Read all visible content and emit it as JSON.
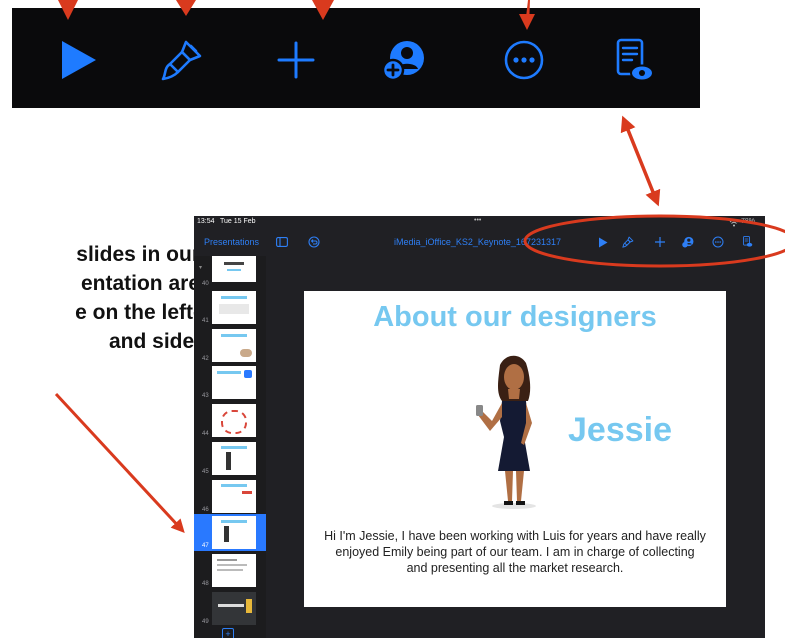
{
  "callout": {
    "lines": [
      "slides in our",
      "entation are",
      "e on the left-",
      "and side."
    ]
  },
  "toolbar_zoom": {
    "icons": [
      "play-icon",
      "format-brush-icon",
      "plus-icon",
      "collaborate-icon",
      "more-icon",
      "presenter-notes-icon"
    ],
    "accent": "#1e7bff"
  },
  "status_bar": {
    "time": "13:54",
    "date": "Tue 15 Feb",
    "dots": "•••",
    "battery": "78%"
  },
  "app_bar": {
    "back_label": "Presentations",
    "doc_title": "iMedia_iOffice_KS2_Keynote_16",
    "doc_title_suffix": "7231317"
  },
  "sidebar": {
    "slide_numbers": [
      "40",
      "41",
      "42",
      "43",
      "44",
      "45",
      "46",
      "47",
      "48",
      "49"
    ],
    "selected": "47",
    "add_label": "+"
  },
  "slide": {
    "title": "About our designers",
    "name": "Jessie",
    "body": "Hi I'm Jessie, I have been working with Luis for years and have really enjoyed Emily being part of our team. I am in charge of collecting and presenting all the market research."
  },
  "colors": {
    "arrow": "#d93a1e",
    "title_blue": "#76c8f0",
    "ios_blue": "#2e7ff5",
    "selection": "#2979ff"
  }
}
